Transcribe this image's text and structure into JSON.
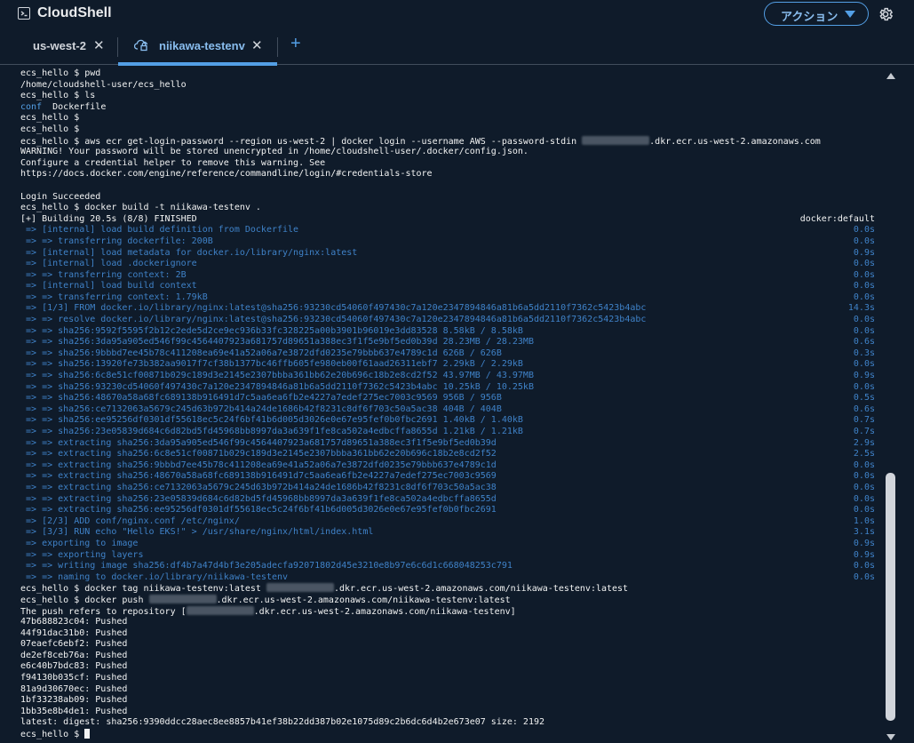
{
  "header": {
    "app_icon": "terminal-icon",
    "title": "CloudShell",
    "action_label": "アクション",
    "action_caret": "caret-down-icon",
    "settings_icon": "gear-icon"
  },
  "tabs": [
    {
      "label": "us-west-2",
      "close": "✕",
      "active": false
    },
    {
      "label": "niikawa-testenv",
      "close": "✕",
      "active": true,
      "icon": "cloud-lock-icon"
    }
  ],
  "add_tab_label": "+",
  "colors": {
    "accent": "#539fe5",
    "background": "#0f1b2a",
    "output_dim": "#3f82c8"
  },
  "terminal": {
    "lines": [
      {
        "text": "ecs_hello $ pwd"
      },
      {
        "text": "/home/cloudshell-user/ecs_hello"
      },
      {
        "text": "ecs_hello $ ls"
      },
      {
        "text": "conf",
        "text_b": "  Dockerfile",
        "blue_first": true
      },
      {
        "text": "ecs_hello $"
      },
      {
        "text": "ecs_hello $"
      },
      {
        "text": "ecs_hello $ aws ecr get-login-password --region us-west-2 | docker login --username AWS --password-stdin ",
        "redacted": true,
        "text_b": ".dkr.ecr.us-west-2.amazonaws.com"
      },
      {
        "text": "WARNING! Your password will be stored unencrypted in /home/cloudshell-user/.docker/config.json."
      },
      {
        "text": "Configure a credential helper to remove this warning. See"
      },
      {
        "text": "https://docs.docker.com/engine/reference/commandline/login/#credentials-store"
      },
      {
        "text": ""
      },
      {
        "text": "Login Succeeded"
      },
      {
        "text": "ecs_hello $ docker build -t niikawa-testenv ."
      },
      {
        "text": "[+] Building 20.5s (8/8) FINISHED",
        "right": "docker:default"
      },
      {
        "text": " => [internal] load build definition from Dockerfile",
        "right": "0.0s",
        "dim": true
      },
      {
        "text": " => => transferring dockerfile: 200B",
        "right": "0.0s",
        "dim": true
      },
      {
        "text": " => [internal] load metadata for docker.io/library/nginx:latest",
        "right": "0.9s",
        "dim": true
      },
      {
        "text": " => [internal] load .dockerignore",
        "right": "0.0s",
        "dim": true
      },
      {
        "text": " => => transferring context: 2B",
        "right": "0.0s",
        "dim": true
      },
      {
        "text": " => [internal] load build context",
        "right": "0.0s",
        "dim": true
      },
      {
        "text": " => => transferring context: 1.79kB",
        "right": "0.0s",
        "dim": true
      },
      {
        "text": " => [1/3] FROM docker.io/library/nginx:latest@sha256:93230cd54060f497430c7a120e2347894846a81b6a5dd2110f7362c5423b4abc",
        "right": "14.3s",
        "dim": true
      },
      {
        "text": " => => resolve docker.io/library/nginx:latest@sha256:93230cd54060f497430c7a120e2347894846a81b6a5dd2110f7362c5423b4abc",
        "right": "0.0s",
        "dim": true
      },
      {
        "text": " => => sha256:9592f5595f2b12c2ede5d2ce9ec936b33fc328225a00b3901b96019e3dd83528 8.58kB / 8.58kB",
        "right": "0.0s",
        "dim": true
      },
      {
        "text": " => => sha256:3da95a905ed546f99c4564407923a681757d89651a388ec3f1f5e9bf5ed0b39d 28.23MB / 28.23MB",
        "right": "0.6s",
        "dim": true
      },
      {
        "text": " => => sha256:9bbbd7ee45b78c411208ea69e41a52a06a7e3872dfd0235e79bbb637e4789c1d 626B / 626B",
        "right": "0.3s",
        "dim": true
      },
      {
        "text": " => => sha256:13920fe73b382aa9017f7cf38b1377bc46ffb605fe980eb00f61aad26311ebf7 2.29kB / 2.29kB",
        "right": "0.0s",
        "dim": true
      },
      {
        "text": " => => sha256:6c8e51cf00871b029c189d3e2145e2307bbba361bb62e20b696c18b2e8cd2f52 43.97MB / 43.97MB",
        "right": "0.9s",
        "dim": true
      },
      {
        "text": " => => sha256:93230cd54060f497430c7a120e2347894846a81b6a5dd2110f7362c5423b4abc 10.25kB / 10.25kB",
        "right": "0.0s",
        "dim": true
      },
      {
        "text": " => => sha256:48670a58a68fc689138b916491d7c5aa6ea6fb2e4227a7edef275ec7003c9569 956B / 956B",
        "right": "0.5s",
        "dim": true
      },
      {
        "text": " => => sha256:ce7132063a5679c245d63b972b414a24de1686b42f8231c8df6f703c50a5ac38 404B / 404B",
        "right": "0.6s",
        "dim": true
      },
      {
        "text": " => => sha256:ee95256df0301df55618ec5c24f6bf41b6d005d3026e0e67e95fef0b0fbc2691 1.40kB / 1.40kB",
        "right": "0.7s",
        "dim": true
      },
      {
        "text": " => => sha256:23e05839d684c6d82bd5fd45968bb8997da3a639f1fe8ca502a4edbcffa8655d 1.21kB / 1.21kB",
        "right": "0.7s",
        "dim": true
      },
      {
        "text": " => => extracting sha256:3da95a905ed546f99c4564407923a681757d89651a388ec3f1f5e9bf5ed0b39d",
        "right": "2.9s",
        "dim": true
      },
      {
        "text": " => => extracting sha256:6c8e51cf00871b029c189d3e2145e2307bbba361bb62e20b696c18b2e8cd2f52",
        "right": "2.5s",
        "dim": true
      },
      {
        "text": " => => extracting sha256:9bbbd7ee45b78c411208ea69e41a52a06a7e3872dfd0235e79bbb637e4789c1d",
        "right": "0.0s",
        "dim": true
      },
      {
        "text": " => => extracting sha256:48670a58a68fc689138b916491d7c5aa6ea6fb2e4227a7edef275ec7003c9569",
        "right": "0.0s",
        "dim": true
      },
      {
        "text": " => => extracting sha256:ce7132063a5679c245d63b972b414a24de1686b42f8231c8df6f703c50a5ac38",
        "right": "0.0s",
        "dim": true
      },
      {
        "text": " => => extracting sha256:23e05839d684c6d82bd5fd45968bb8997da3a639f1fe8ca502a4edbcffa8655d",
        "right": "0.0s",
        "dim": true
      },
      {
        "text": " => => extracting sha256:ee95256df0301df55618ec5c24f6bf41b6d005d3026e0e67e95fef0b0fbc2691",
        "right": "0.0s",
        "dim": true
      },
      {
        "text": " => [2/3] ADD conf/nginx.conf /etc/nginx/",
        "right": "1.0s",
        "dim": true
      },
      {
        "text": " => [3/3] RUN echo \"Hello EKS!\" > /usr/share/nginx/html/index.html",
        "right": "3.1s",
        "dim": true
      },
      {
        "text": " => exporting to image",
        "right": "0.9s",
        "dim": true
      },
      {
        "text": " => => exporting layers",
        "right": "0.9s",
        "dim": true
      },
      {
        "text": " => => writing image sha256:df4b7a47d4bf3e205adecfa92071802d45e3210e8b97e6c6d1c668048253c791",
        "right": "0.0s",
        "dim": true
      },
      {
        "text": " => => naming to docker.io/library/niikawa-testenv",
        "right": "0.0s",
        "dim": true
      },
      {
        "text": "ecs_hello $ docker tag niikawa-testenv:latest ",
        "redacted": true,
        "text_b": ".dkr.ecr.us-west-2.amazonaws.com/niikawa-testenv:latest"
      },
      {
        "text": "ecs_hello $ docker push ",
        "redacted": true,
        "text_b": ".dkr.ecr.us-west-2.amazonaws.com/niikawa-testenv:latest"
      },
      {
        "text": "The push refers to repository [",
        "redacted": true,
        "text_b": ".dkr.ecr.us-west-2.amazonaws.com/niikawa-testenv]"
      },
      {
        "text": "47b688823c04: Pushed"
      },
      {
        "text": "44f91dac31b0: Pushed"
      },
      {
        "text": "07eaefc6ebf2: Pushed"
      },
      {
        "text": "de2ef8ceb76a: Pushed"
      },
      {
        "text": "e6c40b7bdc83: Pushed"
      },
      {
        "text": "f94130b035cf: Pushed"
      },
      {
        "text": "81a9d30670ec: Pushed"
      },
      {
        "text": "1bf33238ab09: Pushed"
      },
      {
        "text": "1bb35e8b4de1: Pushed"
      },
      {
        "text": "latest: digest: sha256:9390ddcc28aec8ee8857b41ef38b22dd387b02e1075d89c2b6dc6d4b2e673e07 size: 2192"
      },
      {
        "text": "ecs_hello $ ",
        "cursor": true
      }
    ]
  },
  "scrollbar": {
    "position": 1.0
  }
}
